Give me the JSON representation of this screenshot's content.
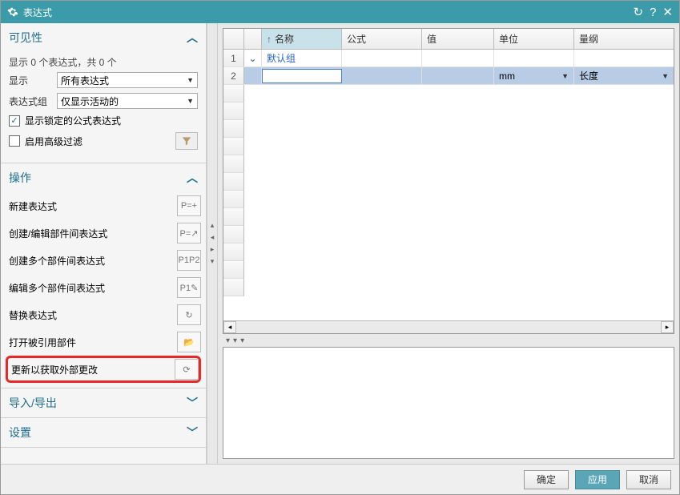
{
  "title": "表达式",
  "sidebar": {
    "visibility": {
      "header": "可见性",
      "status": "显示 0 个表达式，共 0 个",
      "show_label": "显示",
      "show_value": "所有表达式",
      "group_label": "表达式组",
      "group_value": "仅显示活动的",
      "showlocked_label": "显示锁定的公式表达式",
      "enablefilter_label": "启用高级过滤"
    },
    "actions": {
      "header": "操作",
      "items": [
        {
          "label": "新建表达式",
          "icon": "P=+"
        },
        {
          "label": "创建/编辑部件间表达式",
          "icon": "P=↗"
        },
        {
          "label": "创建多个部件间表达式",
          "icon": "P1P2"
        },
        {
          "label": "编辑多个部件间表达式",
          "icon": "P1✎"
        },
        {
          "label": "替换表达式",
          "icon": "↻"
        },
        {
          "label": "打开被引用部件",
          "icon": "📂"
        },
        {
          "label": "更新以获取外部更改",
          "icon": "⟳"
        }
      ]
    },
    "io": {
      "header": "导入/导出"
    },
    "settings": {
      "header": "设置"
    }
  },
  "table": {
    "columns": {
      "name": "名称",
      "formula": "公式",
      "value": "值",
      "unit": "单位",
      "dim": "量纲"
    },
    "rows": [
      {
        "num": "1",
        "expand": "⌄",
        "name": "默认组",
        "group": true
      },
      {
        "num": "2",
        "expand": "",
        "name": "",
        "unit": "mm",
        "dim": "长度",
        "selected": true
      }
    ]
  },
  "footer": {
    "ok": "确定",
    "apply": "应用",
    "cancel": "取消"
  }
}
